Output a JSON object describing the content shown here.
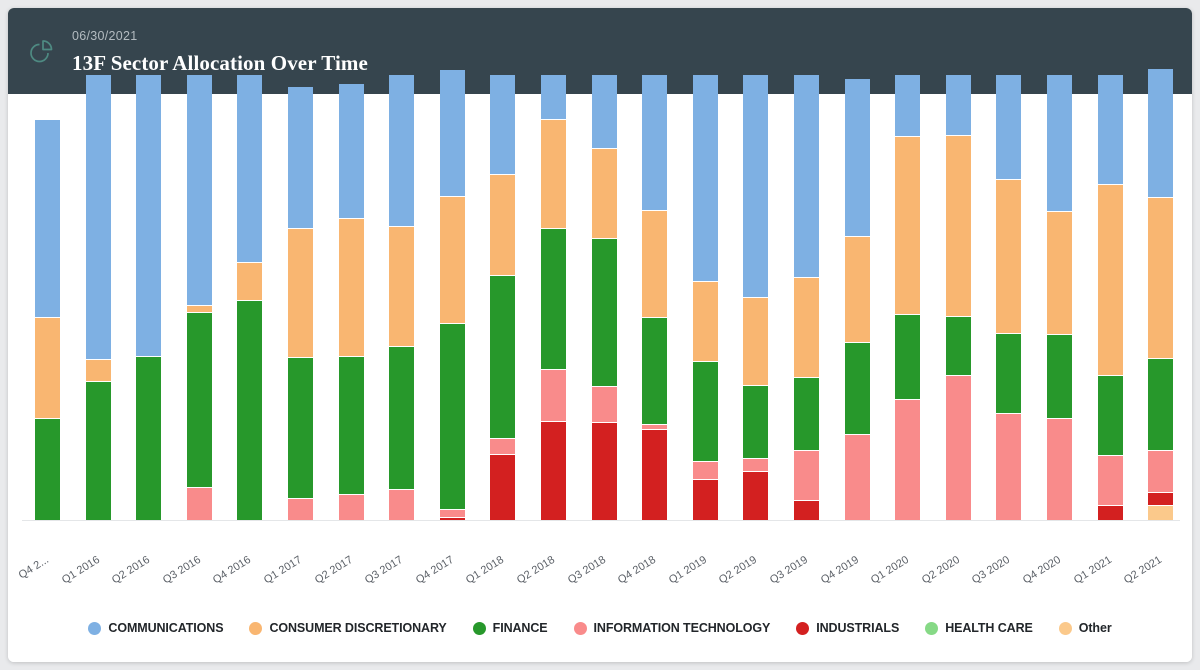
{
  "header": {
    "date": "06/30/2021",
    "title": "13F Sector Allocation Over Time",
    "icon": "pie-chart-icon",
    "background": "#36454e",
    "icon_color": "#4e8a82"
  },
  "chart_data": {
    "type": "bar",
    "stacked": true,
    "normalized": true,
    "title": "13F Sector Allocation Over Time",
    "xlabel": "",
    "ylabel": "",
    "ylim": [
      0,
      100
    ],
    "grid": false,
    "legend_position": "bottom",
    "categories": [
      "Q4 2...",
      "Q1 2016",
      "Q2 2016",
      "Q3 2016",
      "Q4 2016",
      "Q1 2017",
      "Q2 2017",
      "Q3 2017",
      "Q4 2017",
      "Q1 2018",
      "Q2 2018",
      "Q3 2018",
      "Q4 2018",
      "Q1 2019",
      "Q2 2019",
      "Q3 2019",
      "Q4 2019",
      "Q1 2020",
      "Q2 2020",
      "Q3 2020",
      "Q4 2020",
      "Q1 2021",
      "Q2 2021"
    ],
    "series": [
      {
        "name": "COMMUNICATIONS",
        "color": "#7eb0e3",
        "values": [
          44.5,
          64.0,
          63.4,
          51.9,
          42.3,
          32.1,
          30.3,
          34.2,
          28.5,
          22.5,
          10.0,
          16.6,
          30.6,
          46.5,
          50.0,
          45.5,
          35.5,
          14.0,
          13.8,
          23.5,
          30.8,
          24.7,
          29.0
        ]
      },
      {
        "name": "CONSUMER DISCRETIONARY",
        "color": "#f9b671",
        "values": [
          22.7,
          5.0,
          0.0,
          1.6,
          8.5,
          29.0,
          31.1,
          27.0,
          28.5,
          22.7,
          24.7,
          20.2,
          24.0,
          18.0,
          19.9,
          22.5,
          24.0,
          39.9,
          40.5,
          34.6,
          27.6,
          43.0,
          36.3
        ]
      },
      {
        "name": "FINANCE",
        "color": "#27982b",
        "values": [
          22.8,
          31.0,
          36.6,
          39.2,
          49.2,
          31.5,
          31.0,
          32.1,
          41.8,
          36.5,
          31.7,
          33.2,
          24.0,
          22.5,
          16.4,
          16.5,
          20.5,
          19.1,
          13.4,
          18.0,
          18.8,
          18.0,
          20.5
        ]
      },
      {
        "name": "INFORMATION TECHNOLOGY",
        "color": "#f98b8b",
        "values": [
          0.0,
          0.0,
          0.0,
          7.3,
          0.0,
          4.8,
          5.6,
          6.7,
          1.8,
          3.6,
          11.5,
          8.3,
          1.1,
          4.0,
          2.9,
          11.2,
          19.2,
          27.0,
          32.3,
          23.9,
          22.8,
          11.2,
          9.6
        ]
      },
      {
        "name": "INDUSTRIALS",
        "color": "#d32020",
        "values": [
          0.0,
          0.0,
          0.0,
          0.0,
          0.0,
          0.0,
          0.0,
          0.0,
          0.5,
          14.7,
          22.1,
          21.7,
          20.3,
          9.0,
          10.8,
          4.3,
          0.0,
          0.0,
          0.0,
          0.0,
          0.0,
          3.1,
          2.8
        ]
      },
      {
        "name": "HEALTH CARE",
        "color": "#86d986",
        "values": [
          0.0,
          0.0,
          0.0,
          0.0,
          0.0,
          0.0,
          0.0,
          0.0,
          0.0,
          0.0,
          0.0,
          0.0,
          0.0,
          0.0,
          0.0,
          0.0,
          0.0,
          0.0,
          0.0,
          0.0,
          0.0,
          0.0,
          0.0
        ]
      },
      {
        "name": "Other",
        "color": "#fbc98b",
        "values": [
          0.0,
          0.0,
          0.0,
          0.0,
          0.0,
          0.0,
          0.0,
          0.0,
          0.0,
          0.0,
          0.0,
          0.0,
          0.0,
          0.0,
          0.0,
          0.0,
          0.0,
          0.0,
          0.0,
          0.0,
          0.0,
          0.0,
          3.2
        ]
      }
    ]
  }
}
